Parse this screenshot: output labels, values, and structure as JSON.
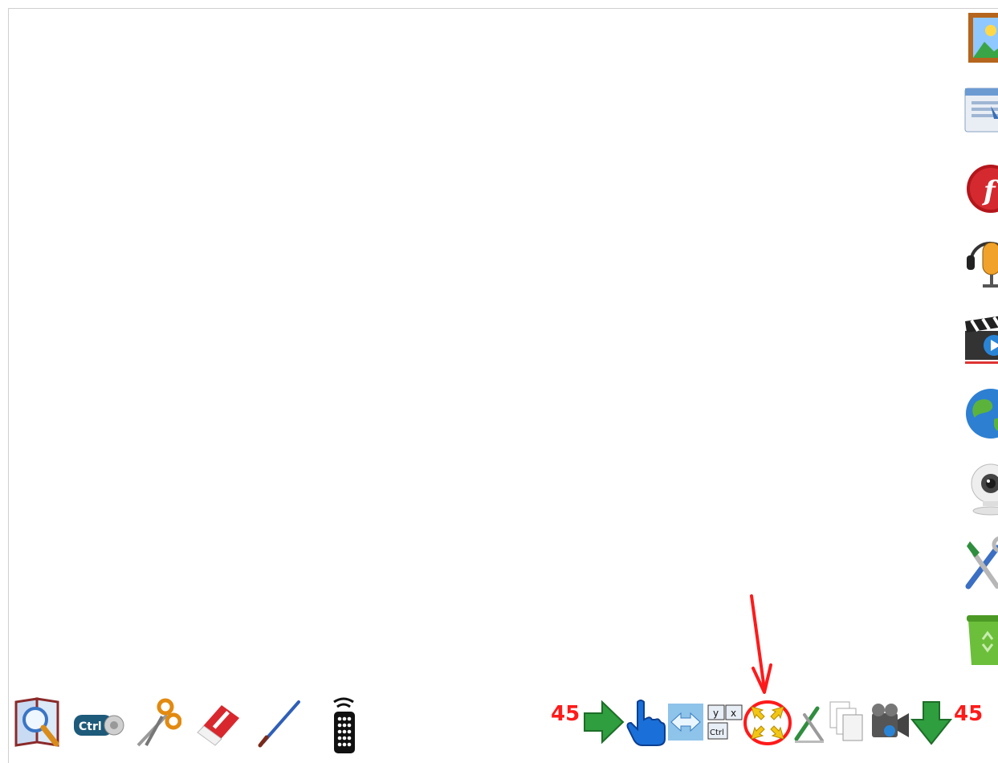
{
  "toolbar_left": {
    "tools": [
      {
        "icon": "magnifier-book-icon"
      },
      {
        "icon": "ctrl-key-icon",
        "label": "Ctrl"
      },
      {
        "icon": "scissors-icon"
      },
      {
        "icon": "eraser-icon"
      },
      {
        "icon": "pen-icon"
      },
      {
        "icon": "remote-control-icon"
      }
    ]
  },
  "toolbar_right": {
    "page_count_left": "45",
    "page_count_right": "45",
    "keys": {
      "y": "y",
      "x": "x",
      "ctrl": "Ctrl"
    }
  },
  "sidebar": {
    "items": [
      {
        "icon": "picture-frame-icon"
      },
      {
        "icon": "window-document-icon"
      },
      {
        "icon": "flash-icon"
      },
      {
        "icon": "microphone-icon"
      },
      {
        "icon": "video-clapper-icon"
      },
      {
        "icon": "globe-icon"
      },
      {
        "icon": "webcam-icon"
      },
      {
        "icon": "tools-icon"
      },
      {
        "icon": "recycle-bin-icon"
      }
    ]
  },
  "colors": {
    "annotation": "#ff1a1a",
    "green_arrow": "#2e9e3e",
    "blue": "#1a6fd8",
    "yellow": "#f2c615"
  }
}
